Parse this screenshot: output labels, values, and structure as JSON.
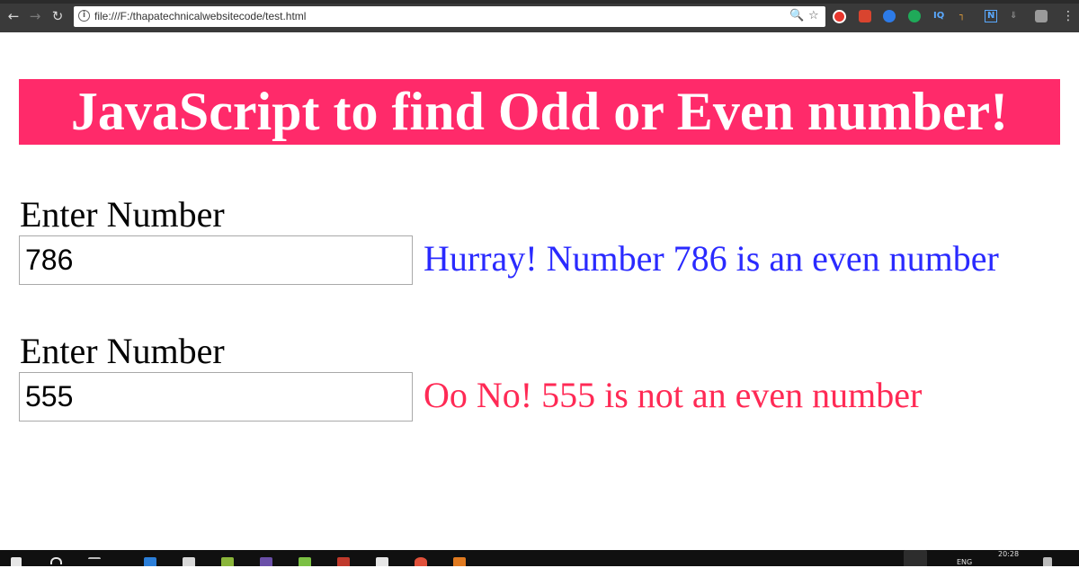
{
  "browser": {
    "url": "file:///F:/thapatechnicalwebsitecode/test.html",
    "back_icon": "back-arrow-icon",
    "forward_icon": "forward-arrow-icon",
    "reload_icon": "reload-icon",
    "extension_labels": {
      "iq": "IQ",
      "n": "N"
    }
  },
  "page": {
    "heading": "JavaScript to find Odd or Even number!",
    "rows": [
      {
        "label": "Enter Number",
        "value": "786",
        "result": "Hurray! Number 786 is an even number",
        "result_color": "#2a2aff"
      },
      {
        "label": "Enter Number",
        "value": "555",
        "result": "Oo No! 555 is not an even number",
        "result_color": "#ff2a55"
      }
    ],
    "banner_color": "#ff2a6a"
  },
  "taskbar": {
    "clock": "20:28",
    "language": "ENG"
  }
}
